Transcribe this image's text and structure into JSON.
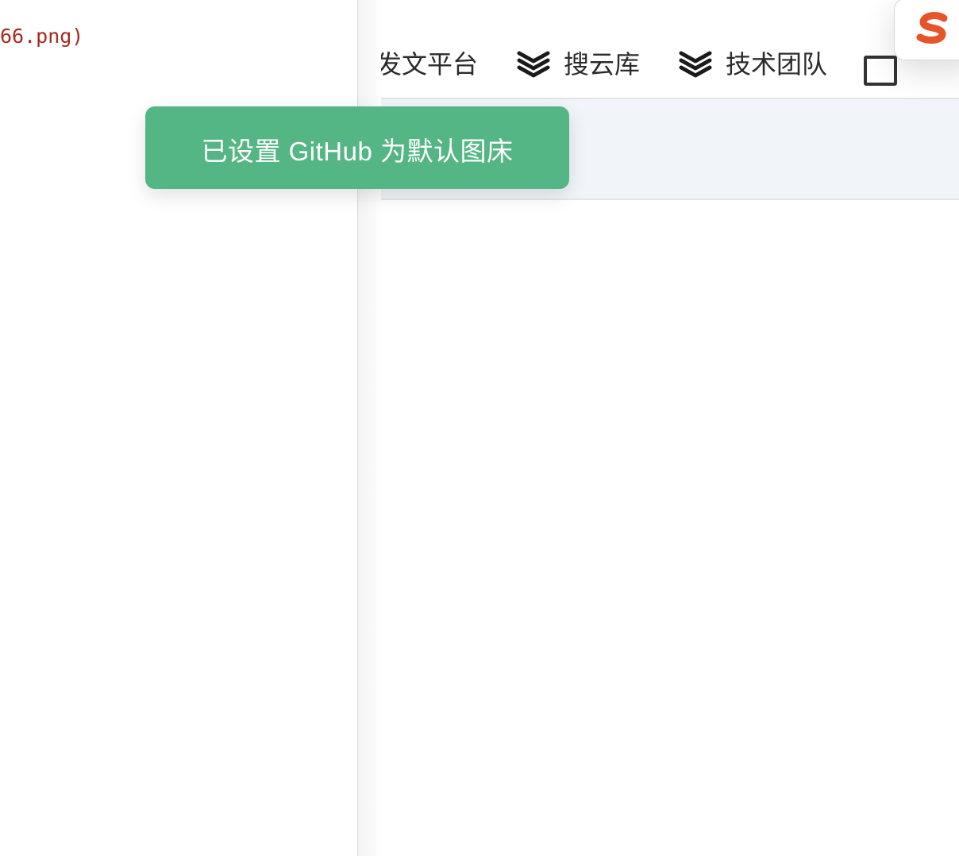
{
  "editor": {
    "visible_line": "66.png)"
  },
  "preview": {
    "nav_items": [
      {
        "label": "发文平台",
        "icon": "none"
      },
      {
        "label": "搜云库",
        "icon": "layers-icon"
      },
      {
        "label": "技术团队",
        "icon": "layers-icon"
      },
      {
        "label": "",
        "icon": "box-icon"
      }
    ],
    "band_color": "#f1f4f9"
  },
  "logo": {
    "icon": "sogou-s-icon",
    "color": "#e8542a"
  },
  "toast": {
    "message": "已设置 GitHub 为默认图床",
    "color": "#55b685"
  }
}
